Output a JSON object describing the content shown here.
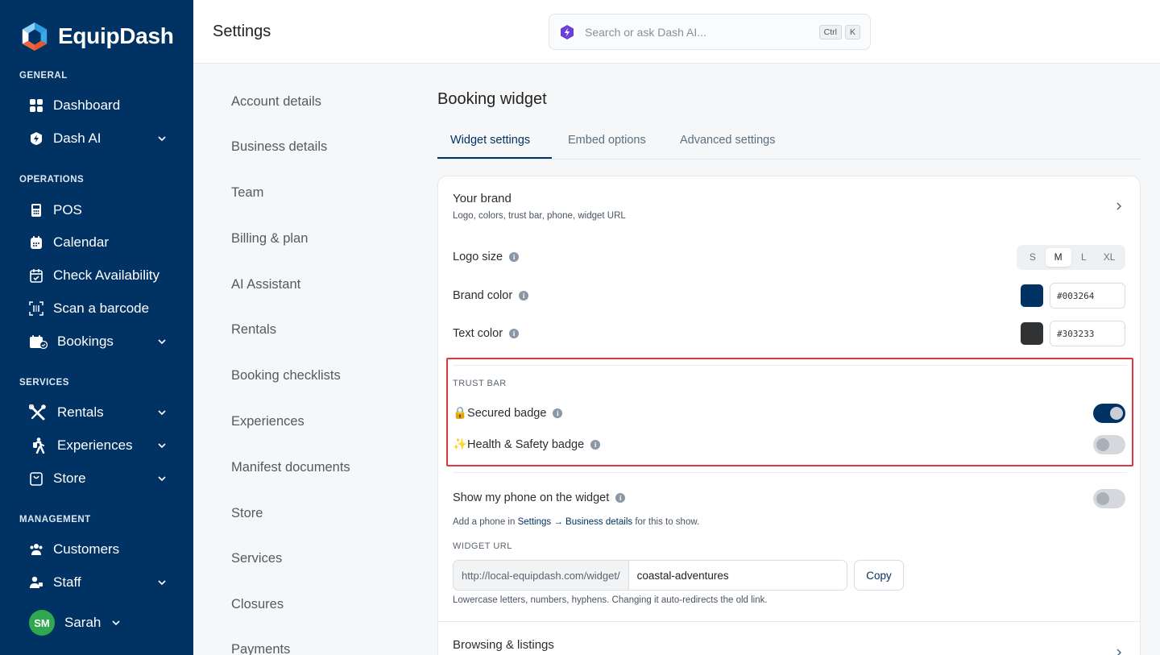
{
  "brand": {
    "name": "EquipDash"
  },
  "sidebar": {
    "sections": {
      "general": "GENERAL",
      "operations": "OPERATIONS",
      "services": "SERVICES",
      "management": "MANAGEMENT"
    },
    "items": {
      "dashboard": "Dashboard",
      "dash_ai": "Dash AI",
      "pos": "POS",
      "calendar": "Calendar",
      "check_availability": "Check Availability",
      "scan_barcode": "Scan a barcode",
      "bookings": "Bookings",
      "rentals": "Rentals",
      "experiences": "Experiences",
      "store": "Store",
      "customers": "Customers",
      "staff": "Staff"
    },
    "user": {
      "initials": "SM",
      "name": "Sarah"
    }
  },
  "topbar": {
    "title": "Settings",
    "search_placeholder": "Search or ask Dash AI...",
    "kbd_ctrl": "Ctrl",
    "kbd_k": "K"
  },
  "settings_nav": [
    "Account details",
    "Business details",
    "Team",
    "Billing & plan",
    "AI Assistant",
    "Rentals",
    "Booking checklists",
    "Experiences",
    "Manifest documents",
    "Store",
    "Services",
    "Closures",
    "Payments"
  ],
  "main": {
    "title": "Booking widget",
    "tabs": [
      "Widget settings",
      "Embed options",
      "Advanced settings"
    ],
    "brand_section": {
      "title": "Your brand",
      "subtitle": "Logo, colors, trust bar, phone, widget URL"
    },
    "logo_size": {
      "label": "Logo size",
      "options": [
        "S",
        "M",
        "L",
        "XL"
      ],
      "selected": "M"
    },
    "brand_color": {
      "label": "Brand color",
      "value": "#003264"
    },
    "text_color": {
      "label": "Text color",
      "value": "#303233"
    },
    "trust_bar": {
      "label": "TRUST BAR",
      "secured": {
        "label": "🔒Secured badge",
        "on": true
      },
      "health": {
        "label": "✨Health & Safety badge",
        "on": false
      }
    },
    "phone": {
      "label": "Show my phone on the widget",
      "on": false,
      "help_prefix": "Add a phone in ",
      "help_link": "Settings → Business details",
      "help_suffix": " for this to show."
    },
    "widget_url": {
      "label": "WIDGET URL",
      "prefix": "http://local-equipdash.com/widget/",
      "slug": "coastal-adventures",
      "copy": "Copy",
      "help": "Lowercase letters, numbers, hyphens. Changing it auto-redirects the old link."
    },
    "browsing": {
      "title": "Browsing & listings"
    }
  },
  "colors": {
    "sidebar": "#003264",
    "accent": "#003264",
    "text": "#303233",
    "highlight": "#d93a46",
    "avatar": "#2fa84f"
  }
}
